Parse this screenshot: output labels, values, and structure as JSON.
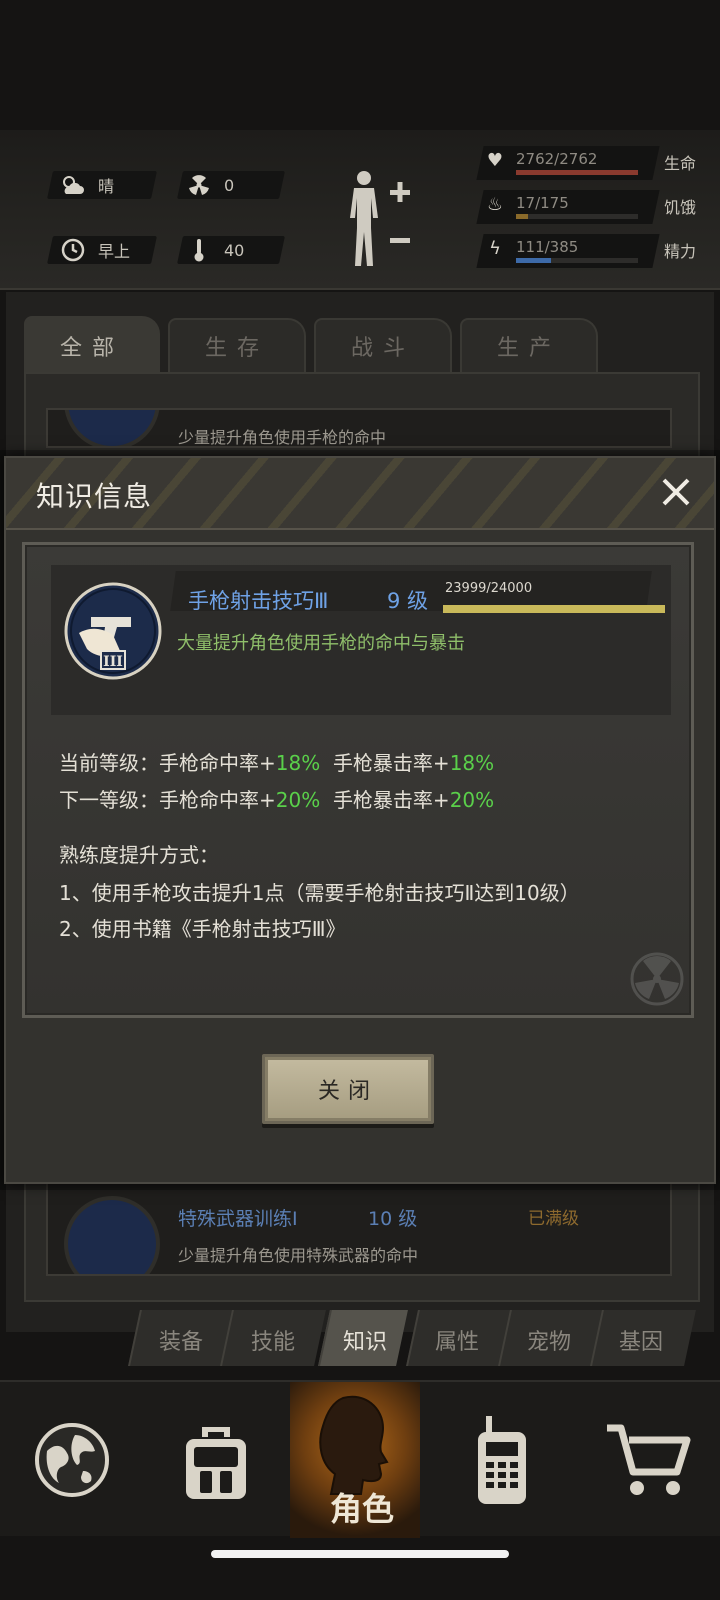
{
  "status": {
    "weather": "晴",
    "radiation": "0",
    "time_of_day": "早上",
    "temperature": "40",
    "health": {
      "value": "2762/2762",
      "label": "生命",
      "fraction": 1.0,
      "color": "#8a3a2e"
    },
    "hunger": {
      "value": "17/175",
      "label": "饥饿",
      "fraction": 0.097,
      "color": "#8a6a2a"
    },
    "energy": {
      "value": "111/385",
      "label": "精力",
      "fraction": 0.288,
      "color": "#3d6aa8"
    }
  },
  "category_tabs": [
    "全部",
    "生存",
    "战斗",
    "生产"
  ],
  "list": {
    "top_item_desc": "少量提升角色使用手枪的命中",
    "bottom_item": {
      "name": "特殊武器训练Ⅰ",
      "level": "10 级",
      "status": "已满级",
      "desc": "少量提升角色使用特殊武器的命中"
    }
  },
  "modal": {
    "title": "知识信息",
    "skill": {
      "name": "手枪射击技巧Ⅲ",
      "level": "9 级",
      "xp": "23999/24000",
      "xp_fraction": 0.99996,
      "desc": "大量提升角色使用手枪的命中与暴击",
      "badge": "III"
    },
    "current_label": "当前等级：",
    "current_stat1": "手枪命中率+",
    "current_val1": "18%",
    "current_stat2": "手枪暴击率+",
    "current_val2": "18%",
    "next_label": "下一等级：",
    "next_stat1": "手枪命中率+",
    "next_val1": "20%",
    "next_stat2": "手枪暴击率+",
    "next_val2": "20%",
    "method_title": "熟练度提升方式：",
    "method_1": "1、使用手枪攻击提升1点（需要手枪射击技巧Ⅱ达到10级）",
    "method_2": "2、使用书籍《手枪射击技巧Ⅲ》",
    "close_label": "关闭"
  },
  "sub_tabs": [
    "装备",
    "技能",
    "知识",
    "属性",
    "宠物",
    "基因"
  ],
  "sub_tab_active": "知识",
  "bottom_nav": {
    "active_label": "角色"
  },
  "colors": {
    "green_value": "#5ad04a",
    "skill_blue": "#6fa2e6",
    "desc_green": "#8fbf6a"
  }
}
